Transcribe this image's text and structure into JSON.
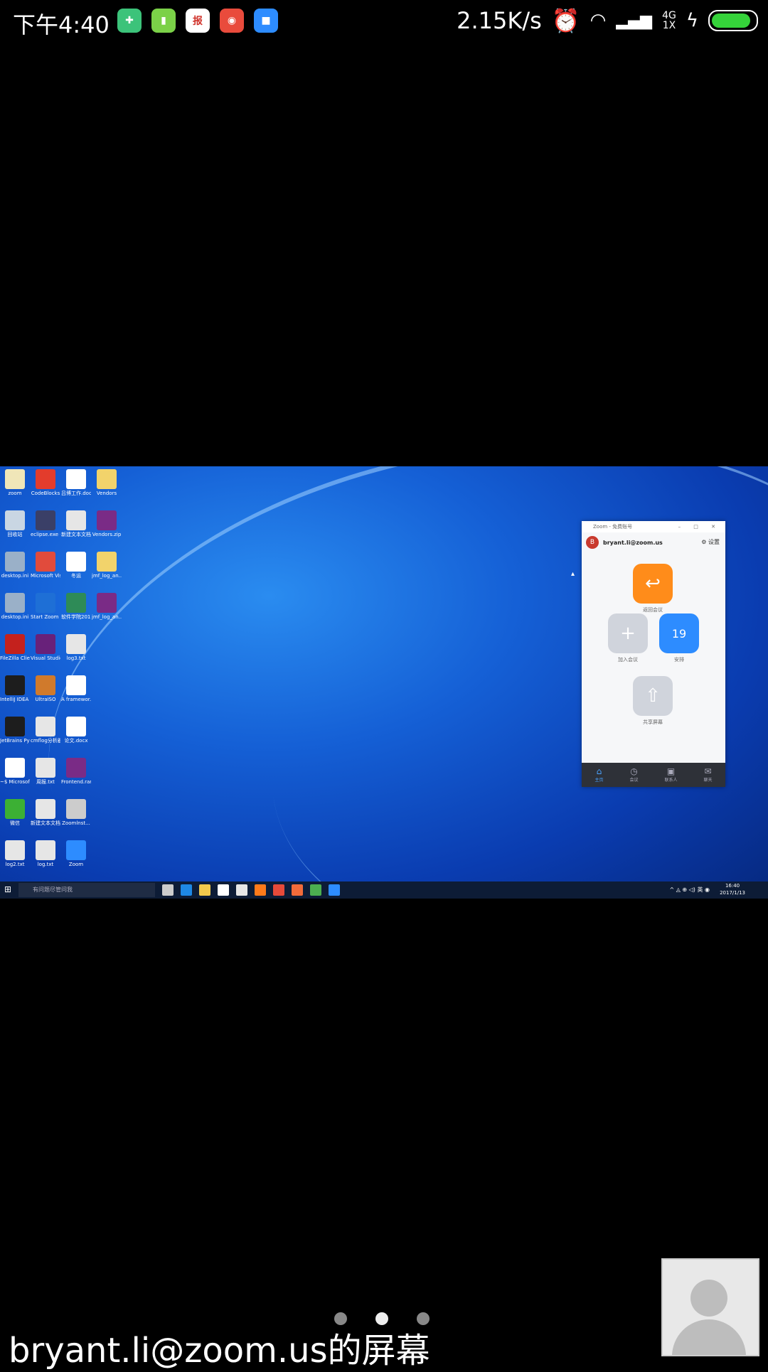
{
  "status_bar": {
    "time": "下午4:40",
    "apps": [
      {
        "icon": "shield-app-icon",
        "color": "#3cc37a",
        "glyph": "✚"
      },
      {
        "icon": "battery-app-icon",
        "color": "#7bd148",
        "glyph": "▮"
      },
      {
        "icon": "news-app-icon",
        "color": "#ffffff",
        "glyph": "报",
        "fg": "#d0332b"
      },
      {
        "icon": "globe-app-icon",
        "color": "#e94b3c",
        "glyph": "◉"
      },
      {
        "icon": "zoom-app-icon",
        "color": "#2d8cff",
        "glyph": "■"
      }
    ],
    "net_speed": "2.15K/s",
    "net_type_top": "4G",
    "net_type_bottom": "1X",
    "battery_level": 0.9,
    "battery_color": "#35d33a"
  },
  "desktop": {
    "icons": [
      {
        "label": "zoom",
        "color": "#f0e6b8"
      },
      {
        "label": "CodeBlocks",
        "color": "#e33c2c"
      },
      {
        "label": "吕博工作.docx",
        "color": "#ffffff"
      },
      {
        "label": "Vendors",
        "color": "#f2d36b"
      },
      {
        "label": "回收站",
        "color": "#c9d6e3"
      },
      {
        "label": "eclipse.exe - 快捷方式",
        "color": "#3a3f67"
      },
      {
        "label": "新建文本文档(2).txt",
        "color": "#e6e6e6"
      },
      {
        "label": "Vendors.zip",
        "color": "#7a2b86"
      },
      {
        "label": "desktop.ini",
        "color": "#9ab0c8"
      },
      {
        "label": "Microsoft Visual Stu...",
        "color": "#e14b3c"
      },
      {
        "label": "冬运",
        "color": "#ffffff"
      },
      {
        "label": "jmf_log_an...",
        "color": "#f2d36b"
      },
      {
        "label": "desktop.ini",
        "color": "#9ab0c8"
      },
      {
        "label": "Start Zoom Rooms",
        "color": "#1e6fd6"
      },
      {
        "label": "软件学院2017届毕...",
        "color": "#2e8b57"
      },
      {
        "label": "jmf_log_an...",
        "color": "#7a2b86"
      },
      {
        "label": "FileZilla Client",
        "color": "#c4211d"
      },
      {
        "label": "Visual Studio 2015",
        "color": "#68217a"
      },
      {
        "label": "log3.txt",
        "color": "#e6e6e6"
      },
      {
        "label": "IntelliJ IDEA 2016.2.4(64)",
        "color": "#1d1d1d"
      },
      {
        "label": "UltraISO",
        "color": "#d07a2c"
      },
      {
        "label": "A framewor...",
        "color": "#ffffff"
      },
      {
        "label": "JetBrains PyCharm...",
        "color": "#1d1d1d"
      },
      {
        "label": "cmflog分析器工作...",
        "color": "#e6e6e6"
      },
      {
        "label": "论文.docx",
        "color": "#ffffff"
      },
      {
        "label": "~$ Microsof...",
        "color": "#ffffff"
      },
      {
        "label": "周报.txt",
        "color": "#e6e6e6"
      },
      {
        "label": "Frontend.rar",
        "color": "#7a2b86"
      },
      {
        "label": "微信",
        "color": "#3cb034"
      },
      {
        "label": "新建文本文档.txt",
        "color": "#e6e6e6"
      },
      {
        "label": "Zoomlnst...",
        "color": "#cccccc"
      },
      {
        "label": "log2.txt",
        "color": "#e6e6e6"
      },
      {
        "label": "log.txt",
        "color": "#e6e6e6"
      },
      {
        "label": "Zoom",
        "color": "#2d8cff"
      }
    ],
    "taskbar": {
      "start_glyph": "⊞",
      "search_placeholder": "有问题尽管问我",
      "apps": [
        "#cccccc",
        "#1e88e5",
        "#f2c94c",
        "#ffffff",
        "#e6e6e6",
        "#ff7a1a",
        "#e64a3a",
        "#f26b3a",
        "#4caf50",
        "#2d8cff"
      ],
      "tray_text": "^ ◬ ⊕ ◁) 英 ◉",
      "clock_time": "16:40",
      "clock_date": "2017/1/13"
    }
  },
  "zoom_window": {
    "title": "Zoom - 免费账号",
    "controls": "– □ ✕",
    "user_initial": "B",
    "user_email": "bryant.li@zoom.us",
    "settings_label": "⚙ 设置",
    "buttons": [
      {
        "label": "返回会议",
        "glyph": "↩",
        "color": "#ff8c1a"
      },
      {
        "label": "加入会议",
        "glyph": "+",
        "color": "#d0d4dc"
      },
      {
        "label": "安排",
        "glyph": "19",
        "color": "#2d8cff"
      },
      {
        "label": "共享屏幕",
        "glyph": "⇧",
        "color": "#d0d4dc"
      }
    ],
    "nav": [
      {
        "label": "主页",
        "glyph": "⌂"
      },
      {
        "label": "会议",
        "glyph": "◷"
      },
      {
        "label": "联系人",
        "glyph": "▣"
      },
      {
        "label": "聊天",
        "glyph": "✉"
      }
    ]
  },
  "screen_share": {
    "sharer_caption": "bryant.li@zoom.us的屏幕",
    "page_dots": 3,
    "active_dot": 1
  }
}
